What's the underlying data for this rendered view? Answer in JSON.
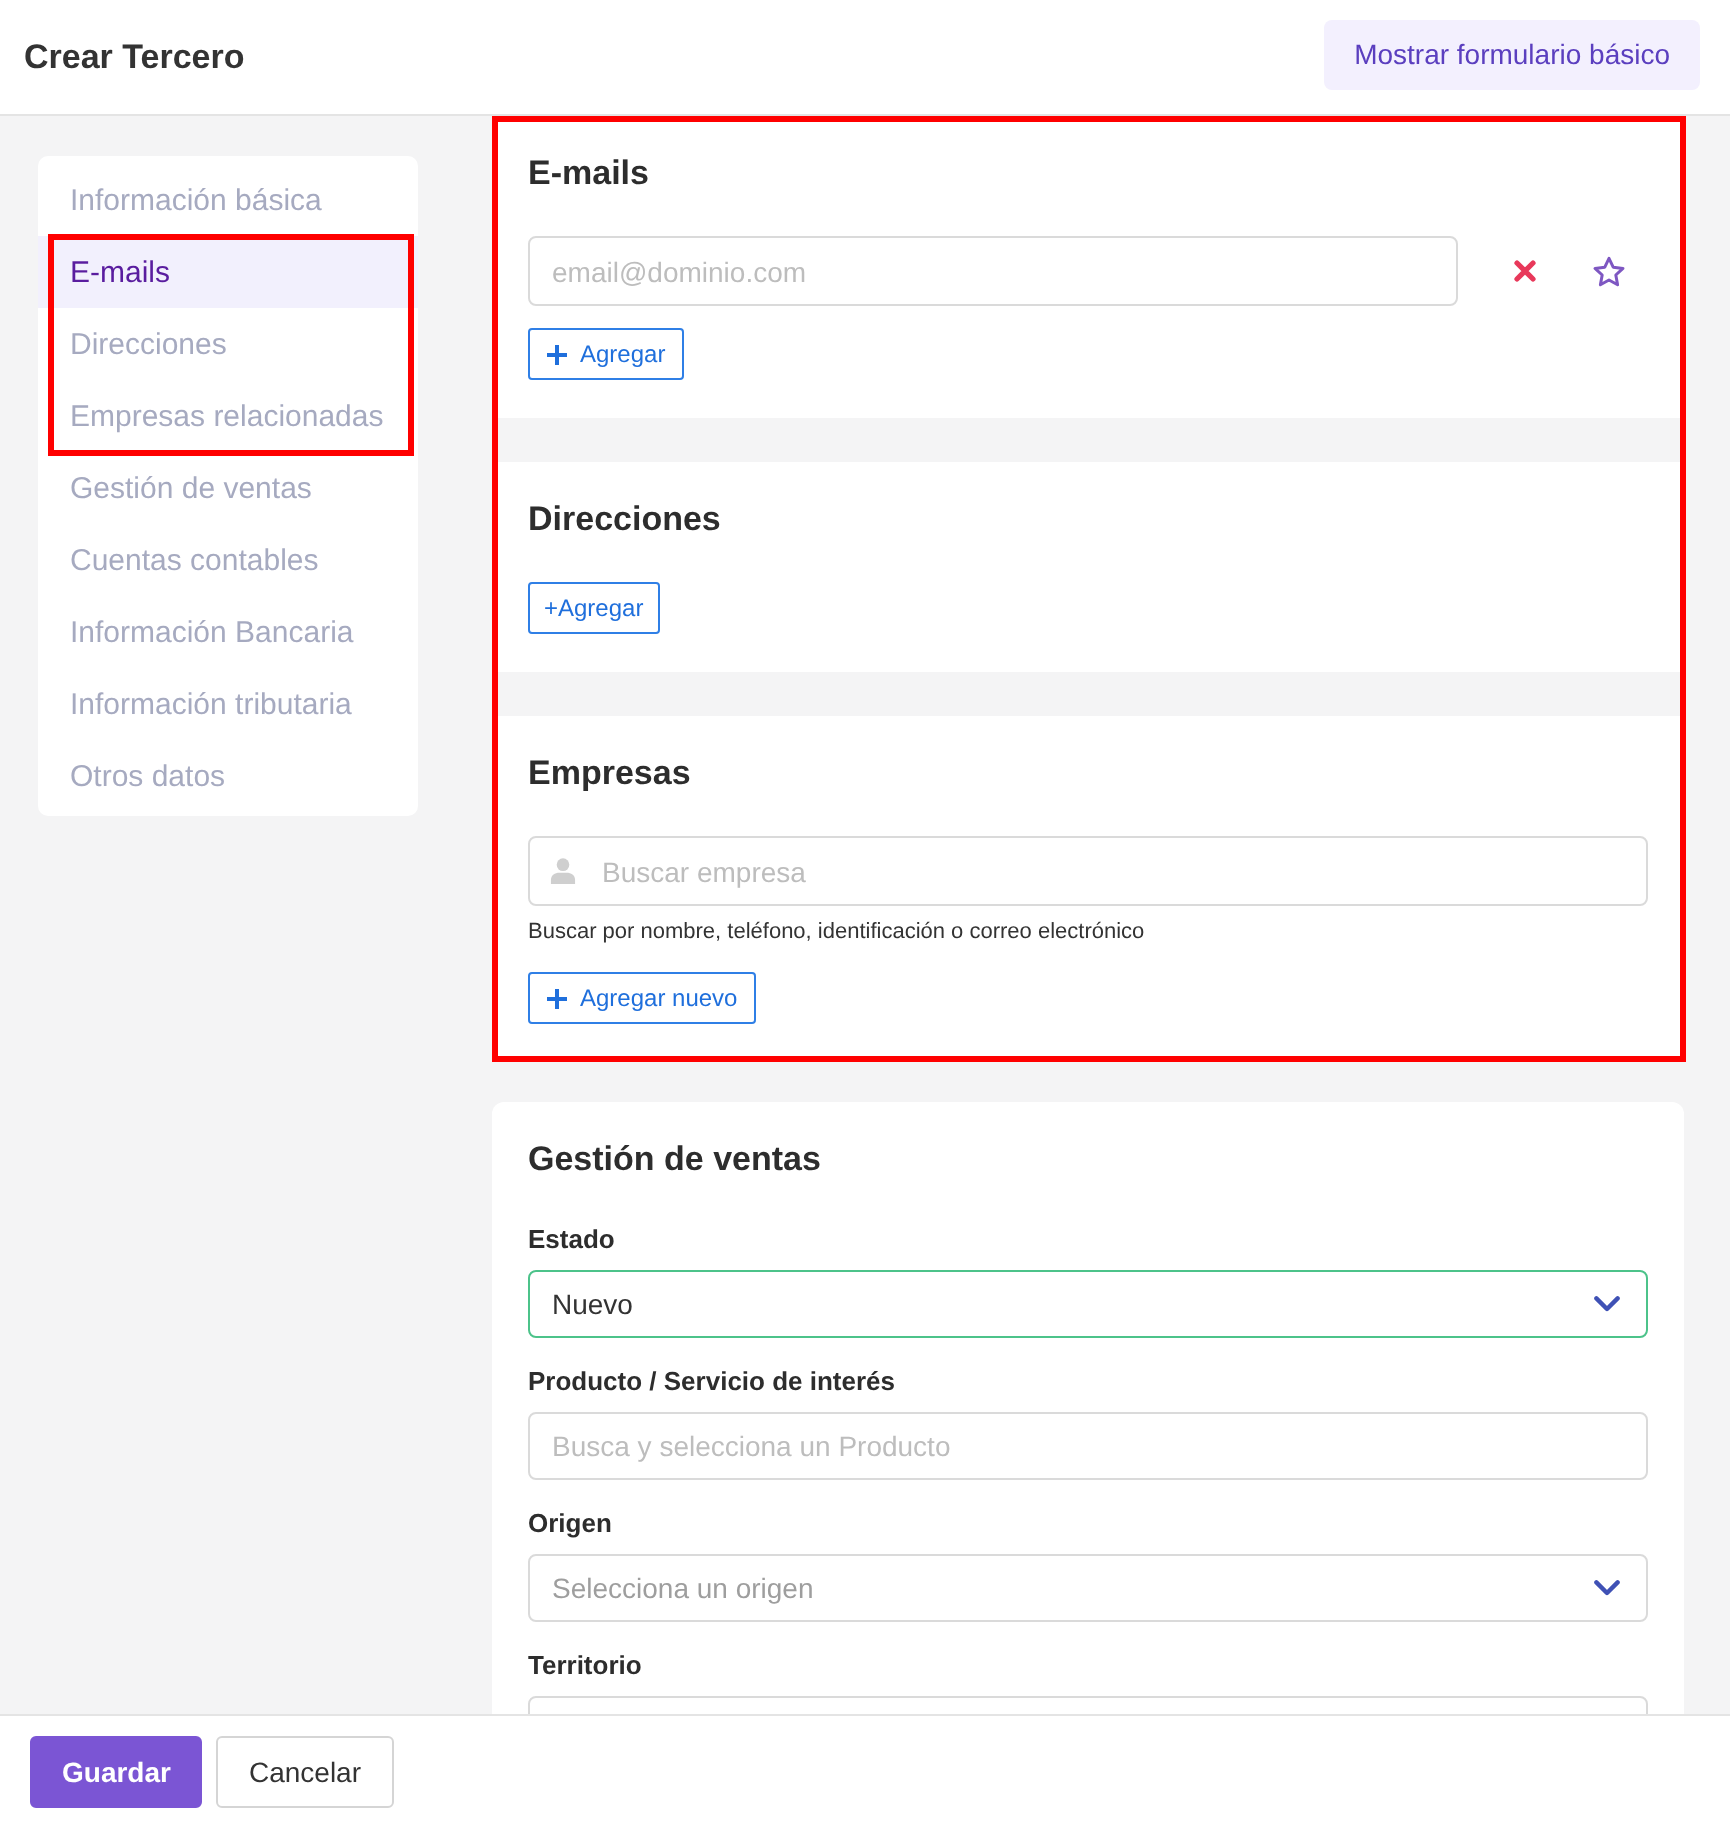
{
  "header": {
    "title": "Crear Tercero",
    "button": "Mostrar formulario básico"
  },
  "sidebar": {
    "items": [
      {
        "label": "Información básica",
        "selected": false,
        "highlighted": false
      },
      {
        "label": "E-mails",
        "selected": true,
        "highlighted": true
      },
      {
        "label": "Direcciones",
        "selected": false,
        "highlighted": true
      },
      {
        "label": "Empresas relacionadas",
        "selected": false,
        "highlighted": true
      },
      {
        "label": "Gestión de ventas",
        "selected": false,
        "highlighted": false
      },
      {
        "label": "Cuentas contables",
        "selected": false,
        "highlighted": false
      },
      {
        "label": "Información Bancaria",
        "selected": false,
        "highlighted": false
      },
      {
        "label": "Información tributaria",
        "selected": false,
        "highlighted": false
      },
      {
        "label": "Otros datos",
        "selected": false,
        "highlighted": false
      }
    ]
  },
  "sections": [
    {
      "kind": "emails",
      "title": "E-mails",
      "highlighted": true,
      "email_field": {
        "placeholder": "email@dominio.com"
      },
      "add_button": {
        "label": "Agregar",
        "kind": "with_icon"
      }
    },
    {
      "kind": "addresses",
      "title": "Direcciones",
      "highlighted": true,
      "add_button": {
        "label": "+Agregar",
        "kind": "text_only"
      }
    },
    {
      "kind": "companies",
      "title": "Empresas",
      "highlighted": true,
      "search_field": {
        "placeholder": "Buscar empresa"
      },
      "help_text": "Buscar por nombre, teléfono, identificación o correo electrónico",
      "add_button": {
        "label": "Agregar nuevo",
        "kind": "with_icon"
      }
    },
    {
      "kind": "sales",
      "title": "Gestión de ventas",
      "highlighted": false,
      "fields": [
        {
          "label": "Estado",
          "kind": "select",
          "value": "Nuevo",
          "focused": true
        },
        {
          "label": "Producto / Servicio de interés",
          "kind": "input",
          "placeholder": "Busca y selecciona un Producto",
          "focused": false
        },
        {
          "label": "Origen",
          "kind": "select",
          "placeholder": "Selecciona un origen",
          "focused": false
        },
        {
          "label": "Territorio",
          "kind": "input",
          "focused": false
        }
      ]
    }
  ],
  "footer": {
    "buttons": [
      {
        "label": "Guardar",
        "kind": "primary"
      },
      {
        "label": "Cancelar",
        "kind": "secondary"
      }
    ]
  }
}
